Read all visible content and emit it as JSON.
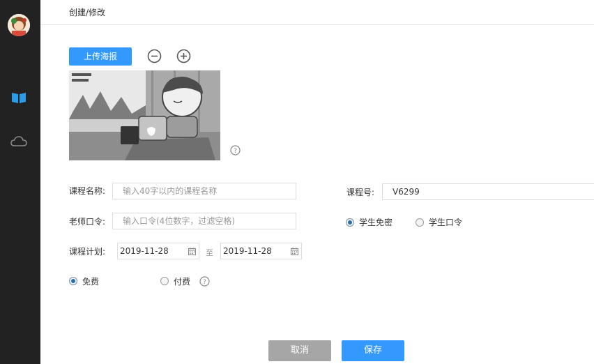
{
  "sidebar": {
    "avatar_icon": "avatar",
    "items": [
      {
        "icon": "book-icon",
        "color": "#2b9be8"
      },
      {
        "icon": "cloud-icon",
        "color": "#8a8a8a"
      }
    ]
  },
  "header": {
    "breadcrumb": "创建/修改"
  },
  "poster": {
    "upload_label": "上传海报",
    "zoom_out_icon": "zoom-out-icon",
    "zoom_in_icon": "zoom-in-icon",
    "help_icon": "help-icon"
  },
  "form": {
    "course_name_label": "课程名称:",
    "course_name_placeholder": "输入40字以内的课程名称",
    "course_number_label": "课程号:",
    "course_number_value": "V6299",
    "teacher_code_label": "老师口令:",
    "teacher_code_placeholder": "输入口令(4位数字，过滤空格)",
    "student_access": {
      "options": [
        "学生免密",
        "学生口令"
      ],
      "selected": "学生免密"
    },
    "schedule_label": "课程计划:",
    "start_date": "2019-11-28",
    "to_label": "至",
    "end_date": "2019-11-28",
    "pricing": {
      "options": [
        "免费",
        "付费"
      ],
      "selected": "免费"
    }
  },
  "actions": {
    "cancel_label": "取消",
    "save_label": "保存"
  },
  "colors": {
    "primary": "#3399ff",
    "sidebar": "#222222",
    "cancel": "#a6a6a6"
  }
}
